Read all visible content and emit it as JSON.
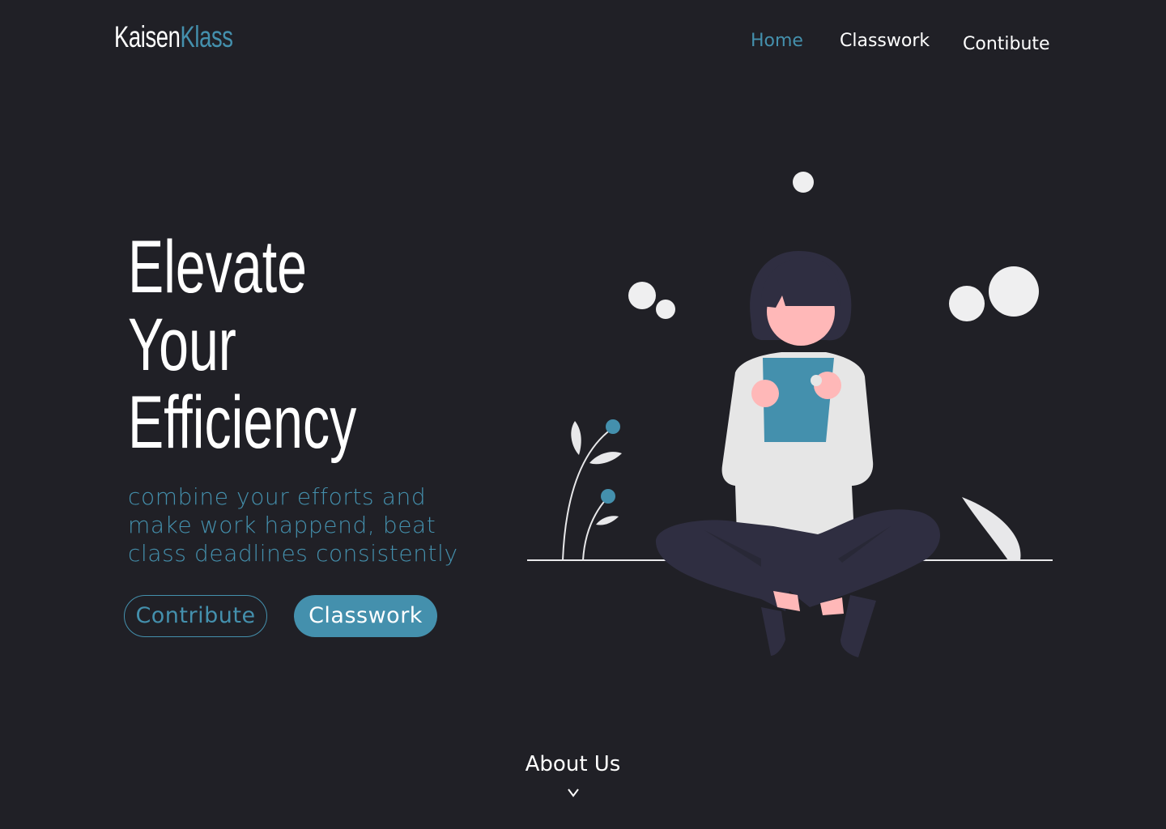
{
  "brand": {
    "name_part_1": "Kaisen",
    "name_part_2": "Klass"
  },
  "nav": {
    "items": [
      {
        "label": "Home",
        "active": true
      },
      {
        "label": "Classwork",
        "active": false
      },
      {
        "label": "Contibute",
        "active": false
      }
    ]
  },
  "hero": {
    "title_lines": [
      "Elevate",
      "Your",
      "Efficiency"
    ],
    "tagline_lines": [
      "combine your efforts and",
      "make work happend, beat",
      "class deadlines consistently"
    ],
    "buttons": {
      "contribute_label": "Contribute",
      "classwork_label": "Classwork"
    }
  },
  "illustration": {
    "icon": "girl-reading-illustration"
  },
  "footer": {
    "about_label": "About Us",
    "scroll_icon": "chevron-down-icon"
  },
  "colors": {
    "background": "#202026",
    "accent": "#4490ad",
    "text": "#ffffff"
  }
}
